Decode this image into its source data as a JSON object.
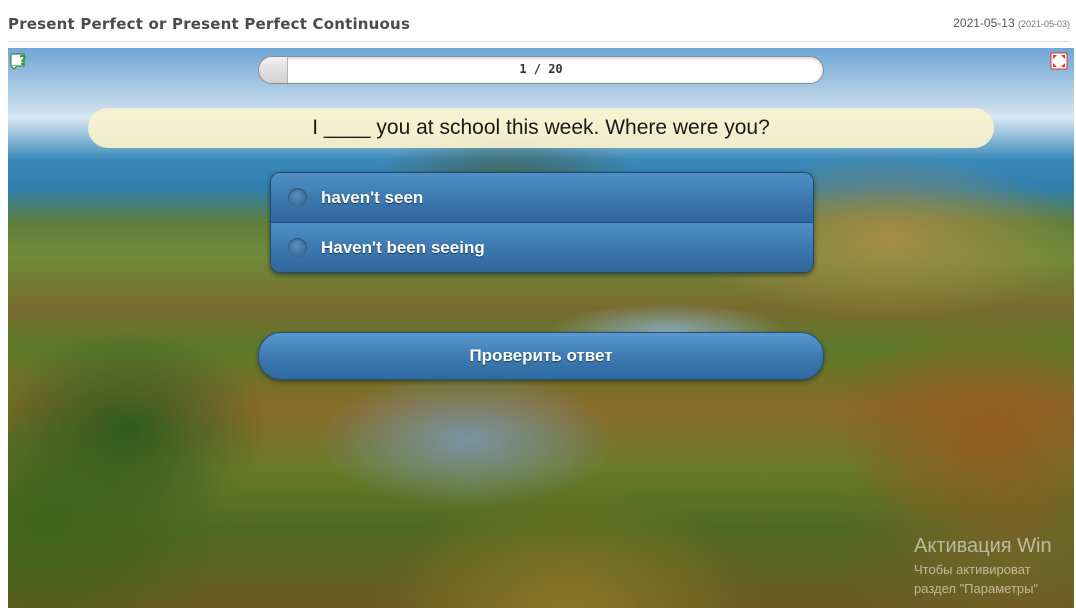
{
  "header": {
    "title": "Present Perfect or Present Perfect Continuous",
    "date": "2021-05-13",
    "date_sub": "(2021-05-03)"
  },
  "quiz": {
    "progress_text": "1 / 20",
    "progress_fraction": 0.05,
    "question": "I ____ you at school this week. Where were you?",
    "answers": [
      {
        "label": "haven't seen",
        "selected": false
      },
      {
        "label": "Haven't been seeing",
        "selected": false
      }
    ],
    "check_button_label": "Проверить ответ"
  },
  "icons": {
    "help": "help-icon",
    "fullscreen": "fullscreen-icon"
  },
  "watermark": {
    "title": "Активация Win",
    "line1": "Чтобы активироват",
    "line2": "раздел \"Параметры\""
  },
  "colors": {
    "button_blue": "#3e7bb2",
    "banner": "#faf2cd"
  }
}
